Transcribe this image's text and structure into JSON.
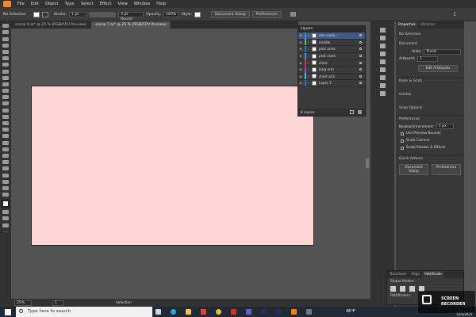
{
  "menubar": {
    "items": [
      "File",
      "Edit",
      "Object",
      "Type",
      "Select",
      "Effect",
      "View",
      "Window",
      "Help"
    ]
  },
  "control": {
    "selection": "No Selection",
    "stroke_label": "Stroke:",
    "stroke_value": "1 pt",
    "brush": "3 pt. Round",
    "opacity_label": "Opacity:",
    "opacity_value": "100%",
    "style_label": "Style:",
    "doc_setup": "Document Setup",
    "preferences": "Preferences"
  },
  "tabs": [
    {
      "label": "scene 6.ai* @ 25 % (RGB/CPU Preview)",
      "active": false
    },
    {
      "label": "scene 7.ai* @ 25 % (RGB/CPU Preview)",
      "active": true
    }
  ],
  "layers": {
    "title": "Layers",
    "rows": [
      {
        "name": "one cactu...",
        "color": "#4f7fe0",
        "selected": true
      },
      {
        "name": "middle",
        "color": "#58c64f",
        "selected": false
      },
      {
        "name": "pink arms",
        "color": "#3a6fd8",
        "selected": false
      },
      {
        "name": "pink clock",
        "color": "#3aa0d8",
        "selected": false
      },
      {
        "name": "clock",
        "color": "#d83a3a",
        "selected": false
      },
      {
        "name": "long arm",
        "color": "#c63ac6",
        "selected": false
      },
      {
        "name": "short arm",
        "color": "#3ac6c6",
        "selected": false
      },
      {
        "name": "Layer 1",
        "color": "#3a6fd8",
        "selected": false
      }
    ],
    "footer": "8 Layers"
  },
  "properties": {
    "tabs": [
      "Properties",
      "Libraries"
    ],
    "no_selection": "No Selection",
    "document": "Document",
    "units_label": "Units:",
    "units_value": "Pixels",
    "artboard_label": "Artboard:",
    "artboard_value": "1",
    "edit_artboards": "Edit Artboards",
    "ruler_grids": "Ruler & Grids",
    "guides": "Guides",
    "snap_options": "Snap Options",
    "preferences_title": "Preferences",
    "keyboard_increment_label": "Keyboard Increment:",
    "keyboard_increment_value": "1 px",
    "checks": [
      "Use Preview Bounds",
      "Scale Corners",
      "Scale Strokes & Effects"
    ],
    "quick_actions": "Quick Actions",
    "doc_setup": "Document Setup",
    "preferences": "Preferences"
  },
  "pathfinder": {
    "tabs": [
      "Transform",
      "Align",
      "Pathfinder"
    ],
    "shape_modes": "Shape Modes:",
    "pathfinders": "Pathfinders:"
  },
  "status": {
    "zoom": "25%",
    "page": "1",
    "mode": "Selection"
  },
  "taskbar": {
    "search_placeholder": "Type here to search",
    "temperature": "46°F",
    "date": "12/1/2021"
  },
  "watermark": {
    "line1": "SCREEN",
    "line2": "RECORDER"
  },
  "colors": {
    "artboard": "#ffd6d6",
    "selected_layer": "#3e5a86"
  }
}
